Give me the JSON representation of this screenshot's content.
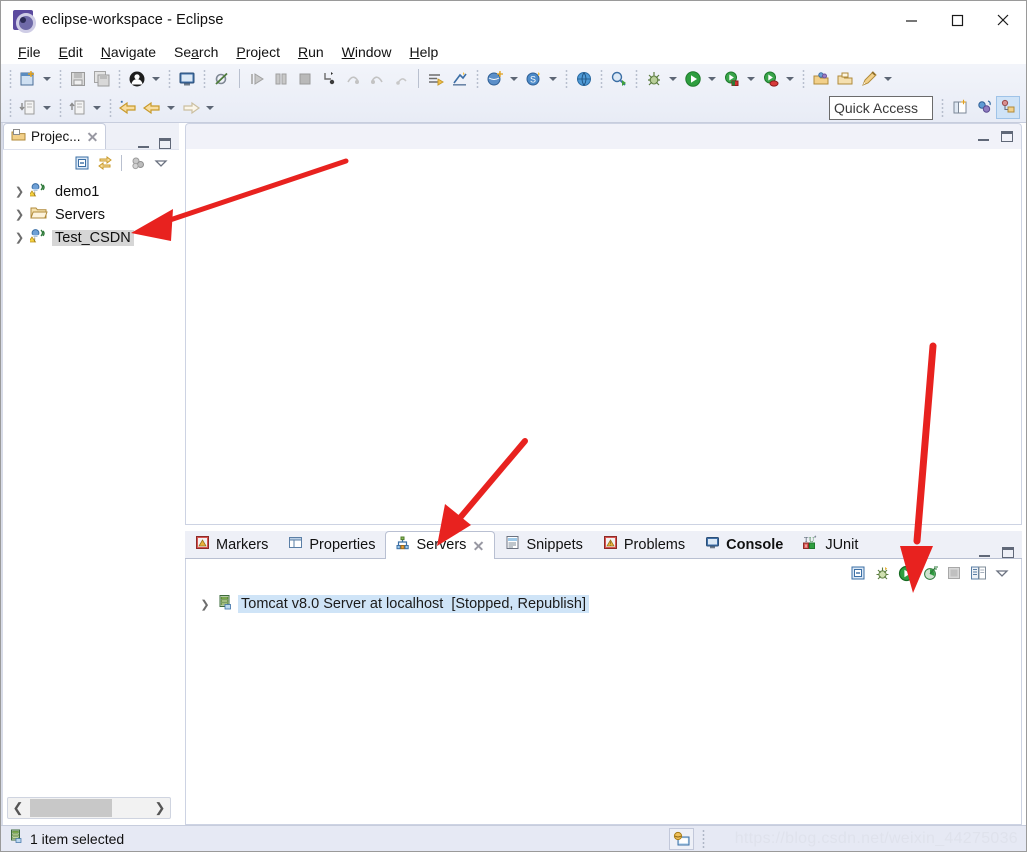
{
  "window": {
    "title": "eclipse-workspace - Eclipse",
    "app_icon": "eclipse-icon",
    "minimize": "minimize-icon",
    "maximize": "maximize-icon",
    "close": "close-icon"
  },
  "menubar": {
    "items": [
      {
        "label": "File",
        "mnemonic": "F"
      },
      {
        "label": "Edit",
        "mnemonic": "E"
      },
      {
        "label": "Navigate",
        "mnemonic": "N"
      },
      {
        "label": "Search",
        "mnemonic": "a"
      },
      {
        "label": "Project",
        "mnemonic": "P"
      },
      {
        "label": "Run",
        "mnemonic": "R"
      },
      {
        "label": "Window",
        "mnemonic": "W"
      },
      {
        "label": "Help",
        "mnemonic": "H"
      }
    ]
  },
  "toolbar": {
    "quick_access_placeholder": "Quick Access",
    "quick_access_value": "",
    "row1_icons": [
      "new-wizard-icon",
      "save-icon",
      "save-all-icon",
      "user-icon",
      "toggle-console-icon",
      "skip-breakpoints-icon",
      "resume-icon",
      "suspend-icon",
      "terminate-icon",
      "step-into-icon",
      "step-over-icon",
      "step-return-icon",
      "step-back-icon",
      "next-annotation-icon",
      "previous-annotation-icon",
      "new-java-project-icon",
      "new-servlet-icon",
      "open-type-icon",
      "open-web-browser-icon",
      "search-icon",
      "debug-icon",
      "run-icon",
      "run-server-icon",
      "profile-server-icon",
      "open-package-icon",
      "open-resource-icon",
      "new-annotation-icon"
    ],
    "row2_icons": [
      "import-icon",
      "export-icon",
      "back-history-icon",
      "back-icon",
      "forward-icon"
    ],
    "perspective_icons": [
      "open-perspective-icon",
      "java-ee-perspective-icon",
      "java-perspective-icon"
    ]
  },
  "explorer": {
    "tab_label": "Projec...",
    "tab_icon": "project-explorer-icon",
    "close_icon": "close-icon",
    "minimize_icon": "minimize-icon",
    "maximize_icon": "maximize-icon",
    "toolbar_icons": [
      "collapse-all-icon",
      "link-with-editor-icon",
      "focus-on-active-task-icon",
      "view-menu-icon"
    ],
    "tree": [
      {
        "label": "demo1",
        "icon": "java-project-icon",
        "expanded": false,
        "selected": false
      },
      {
        "label": "Servers",
        "icon": "folder-icon",
        "expanded": false,
        "selected": false
      },
      {
        "label": "Test_CSDN",
        "icon": "java-project-icon",
        "expanded": false,
        "selected": true
      }
    ],
    "scroll_left_icon": "chevron-left-icon",
    "scroll_right_icon": "chevron-right-icon"
  },
  "editor": {
    "minimize_icon": "minimize-icon",
    "maximize_icon": "maximize-icon",
    "content": ""
  },
  "bottom_panel": {
    "tabs": [
      {
        "label": "Markers",
        "icon": "markers-icon",
        "active": false,
        "bold": false
      },
      {
        "label": "Properties",
        "icon": "properties-icon",
        "active": false,
        "bold": false
      },
      {
        "label": "Servers",
        "icon": "servers-icon",
        "active": true,
        "bold": false
      },
      {
        "label": "Snippets",
        "icon": "snippets-icon",
        "active": false,
        "bold": false
      },
      {
        "label": "Problems",
        "icon": "problems-icon",
        "active": false,
        "bold": false
      },
      {
        "label": "Console",
        "icon": "console-icon",
        "active": false,
        "bold": true
      },
      {
        "label": "JUnit",
        "icon": "junit-icon",
        "active": false,
        "bold": false
      }
    ],
    "close_icon": "close-icon",
    "minimize_icon": "minimize-icon",
    "maximize_icon": "maximize-icon",
    "toolbar_icons": [
      "collapse-all-icon",
      "debug-server-icon",
      "start-server-icon",
      "profile-server-icon",
      "stop-server-icon",
      "publish-icon",
      "view-menu-icon"
    ],
    "servers": [
      {
        "name": "Tomcat v8.0 Server at localhost",
        "state": "[Stopped, Republish]",
        "icon": "tomcat-server-icon",
        "expanded": false,
        "selected": true
      }
    ]
  },
  "statusbar": {
    "icon": "server-status-icon",
    "text": "1 item selected",
    "tool_icon": "build-status-icon",
    "watermark": "https://blog.csdn.net/weixin_44275036"
  },
  "annotations": {
    "arrows": [
      {
        "name": "arrow-to-test-csdn",
        "target": "Test_CSDN project"
      },
      {
        "name": "arrow-to-servers-tab",
        "target": "Servers tab"
      },
      {
        "name": "arrow-to-start-server",
        "target": "Start server button"
      }
    ],
    "color": "#e8221f"
  },
  "colors": {
    "accent": "#e8221f",
    "selection": "#cfe4f7",
    "tree_selection": "#d6d6d6",
    "toolbar_bg": "#eef0f7"
  }
}
